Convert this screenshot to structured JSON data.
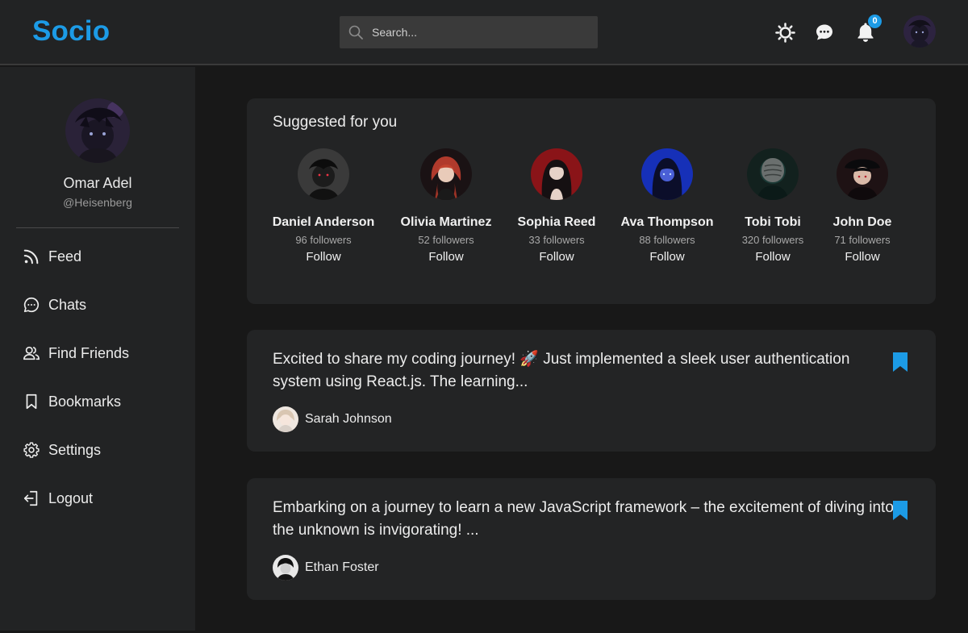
{
  "app": {
    "brand": "Socio"
  },
  "header": {
    "search": {
      "placeholder": "Search...",
      "value": ""
    },
    "notifications_count": "0"
  },
  "profile": {
    "name": "Omar Adel",
    "handle": "@Heisenberg"
  },
  "sidebar": {
    "items": [
      {
        "label": "Feed",
        "icon": "rss-icon"
      },
      {
        "label": "Chats",
        "icon": "chat-icon"
      },
      {
        "label": "Find Friends",
        "icon": "users-icon"
      },
      {
        "label": "Bookmarks",
        "icon": "bookmark-icon"
      },
      {
        "label": "Settings",
        "icon": "gear-icon"
      },
      {
        "label": "Logout",
        "icon": "logout-icon"
      }
    ]
  },
  "suggestions": {
    "title": "Suggested for you",
    "follow_label": "Follow",
    "people": [
      {
        "name": "Daniel Anderson",
        "followers": "96 followers"
      },
      {
        "name": "Olivia Martinez",
        "followers": "52 followers"
      },
      {
        "name": "Sophia Reed",
        "followers": "33 followers"
      },
      {
        "name": "Ava Thompson",
        "followers": "88 followers"
      },
      {
        "name": "Tobi Tobi",
        "followers": "320 followers"
      },
      {
        "name": "John Doe",
        "followers": "71 followers"
      }
    ]
  },
  "posts": [
    {
      "text": "Excited to share my coding journey! 🚀 Just implemented a sleek user authentication system using React.js. The learning...",
      "author": "Sarah Johnson"
    },
    {
      "text": "Embarking on a journey to learn a new JavaScript framework – the excitement of diving into the unknown is invigorating! ...",
      "author": "Ethan Foster"
    }
  ],
  "colors": {
    "accent": "#1c9be6",
    "header_bg": "#222324",
    "page_bg": "#181818",
    "card_bg": "#232425"
  }
}
